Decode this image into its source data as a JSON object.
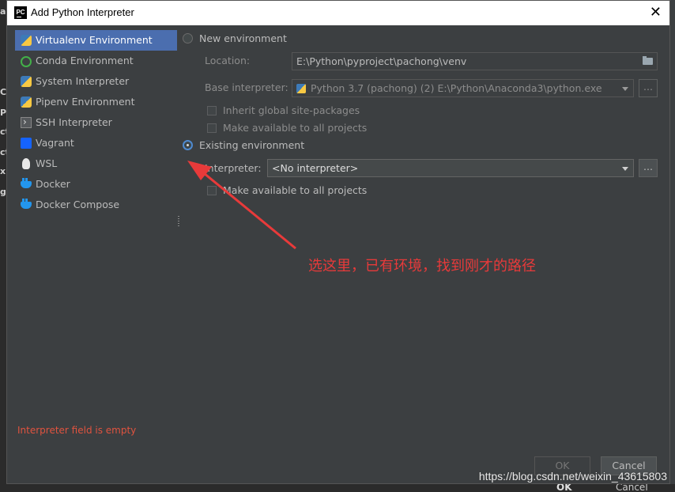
{
  "background": {
    "side_fragments": [
      "ai",
      "C",
      "P",
      "ct",
      "ct",
      "x",
      "g"
    ],
    "ghost_ok": "OK",
    "ghost_cancel": "Cancel"
  },
  "window": {
    "title": "Add Python Interpreter",
    "app_icon_text": "PC",
    "close_glyph": "✕"
  },
  "sidebar": {
    "items": [
      {
        "label": "Virtualenv Environment",
        "icon": "python-icon",
        "selected": true
      },
      {
        "label": "Conda Environment",
        "icon": "conda-icon"
      },
      {
        "label": "System Interpreter",
        "icon": "python-icon"
      },
      {
        "label": "Pipenv Environment",
        "icon": "python-icon"
      },
      {
        "label": "SSH Interpreter",
        "icon": "terminal-icon"
      },
      {
        "label": "Vagrant",
        "icon": "vagrant-icon"
      },
      {
        "label": "WSL",
        "icon": "linux-icon"
      },
      {
        "label": "Docker",
        "icon": "docker-icon"
      },
      {
        "label": "Docker Compose",
        "icon": "docker-icon"
      }
    ]
  },
  "new_env": {
    "radio_label": "New environment",
    "location_label": "Location:",
    "location_value": "E:\\Python\\pyproject\\pachong\\venv",
    "base_label": "Base interpreter:",
    "base_value": "Python 3.7 (pachong) (2) E:\\Python\\Anaconda3\\python.exe",
    "inherit_label": "Inherit global site-packages",
    "available_label": "Make available to all projects",
    "dots": "..."
  },
  "existing_env": {
    "radio_label": "Existing environment",
    "interpreter_label": "Interpreter:",
    "interpreter_value": "<No interpreter>",
    "available_label": "Make available to all projects",
    "dots": "..."
  },
  "error": "Interpreter field is empty",
  "buttons": {
    "ok": "OK",
    "cancel": "Cancel"
  },
  "annotation": "选这里，已有环境，找到刚才的路径",
  "watermark": "https://blog.csdn.net/weixin_43615803",
  "colors": {
    "accent": "#4b6eaf",
    "error": "#e0533f",
    "annotation": "#e83a3a"
  }
}
